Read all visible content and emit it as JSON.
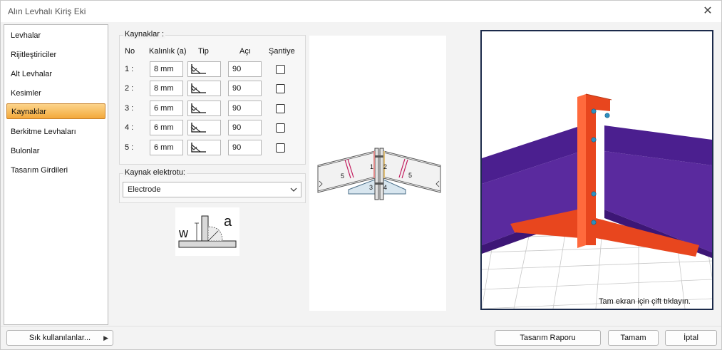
{
  "window": {
    "title": "Alın Levhalı Kiriş Eki"
  },
  "sidebar": {
    "items": [
      {
        "label": "Levhalar",
        "active": false
      },
      {
        "label": "Rijitleştiriciler",
        "active": false
      },
      {
        "label": "Alt Levhalar",
        "active": false
      },
      {
        "label": "Kesimler",
        "active": false
      },
      {
        "label": "Kaynaklar",
        "active": true
      },
      {
        "label": "Berkitme Levhaları",
        "active": false
      },
      {
        "label": "Bulonlar",
        "active": false
      },
      {
        "label": "Tasarım Girdileri",
        "active": false
      }
    ]
  },
  "welds": {
    "group_label": "Kaynaklar :",
    "headers": {
      "no": "No",
      "thickness": "Kalınlık (a)",
      "type": "Tip",
      "angle": "Açı",
      "site": "Şantiye"
    },
    "rows": [
      {
        "no": "1 :",
        "thickness": "8 mm",
        "angle": "90",
        "site": false
      },
      {
        "no": "2 :",
        "thickness": "8 mm",
        "angle": "90",
        "site": false
      },
      {
        "no": "3 :",
        "thickness": "6 mm",
        "angle": "90",
        "site": false
      },
      {
        "no": "4 :",
        "thickness": "6 mm",
        "angle": "90",
        "site": false
      },
      {
        "no": "5 :",
        "thickness": "6 mm",
        "angle": "90",
        "site": false
      }
    ]
  },
  "electrode": {
    "label": "Kaynak elektrotu:",
    "value": "Electrode"
  },
  "weld_sketch": {
    "w_label": "w",
    "a_label": "a"
  },
  "diagram": {
    "labels": [
      "1",
      "2",
      "3",
      "4",
      "5",
      "5"
    ]
  },
  "view3d": {
    "hint": "Tam ekran için çift tıklayın."
  },
  "footer": {
    "favorites": "Sık kullanılanlar...",
    "favorites_arrow": "▶",
    "report": "Tasarım Raporu",
    "ok": "Tamam",
    "cancel": "İptal"
  },
  "colors": {
    "accent": "#f3a93b",
    "beam": "#5a2a9e",
    "plate": "#e8461e",
    "bolt": "#2e8fbf"
  }
}
